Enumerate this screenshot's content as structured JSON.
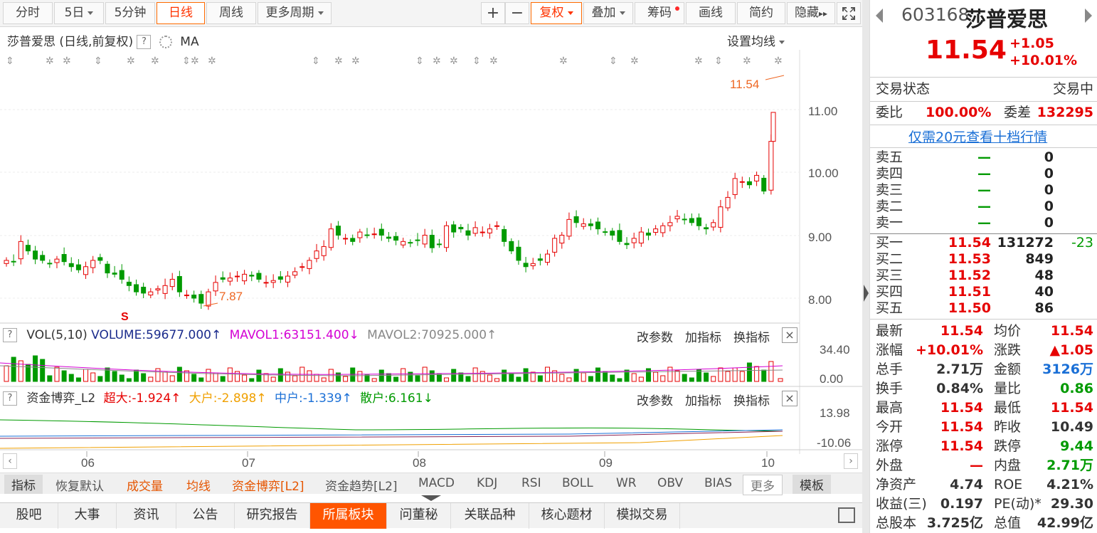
{
  "toolbar": {
    "items": [
      "分时",
      "5日",
      "5分钟",
      "日线",
      "周线",
      "更多周期"
    ],
    "right_items": [
      "复权",
      "叠加",
      "筹码",
      "画线",
      "简约",
      "隐藏"
    ],
    "plus": "+",
    "minus": "−",
    "hide_arrows": "▸▸"
  },
  "chart": {
    "title": "莎普爱思 (日线,前复权)",
    "help": "?",
    "ma_label": "MA",
    "ma_setting": "设置均线",
    "price_axis": [
      "11.00",
      "10.00",
      "9.00",
      "8.00"
    ],
    "high_marker": "11.54",
    "low_marker": "7.87",
    "s_marker": "S",
    "months": [
      "06",
      "07",
      "08",
      "09",
      "10"
    ]
  },
  "volume": {
    "help": "?",
    "label": "VOL(5,10)",
    "volume": "VOLUME:59677.000",
    "mavol1": "MAVOL1:63151.400",
    "mavol2": "MAVOL2:70925.000",
    "axis": [
      "34.40",
      "0.00"
    ],
    "buttons": [
      "改参数",
      "加指标",
      "换指标"
    ],
    "close": "×"
  },
  "capital": {
    "help": "?",
    "label": "资金博弈_L2",
    "chaoda": "超大:-1.924",
    "dahu": "大户:-2.898",
    "zhonghu": "中户:-1.339",
    "sanhu": "散户:6.161",
    "axis": [
      "13.98",
      "-10.06"
    ],
    "buttons": [
      "改参数",
      "加指标",
      "换指标"
    ],
    "close": "×"
  },
  "indicators": [
    "指标",
    "恢复默认",
    "成交量",
    "均线",
    "资金博弈[L2]",
    "资金趋势[L2]",
    "MACD",
    "KDJ",
    "RSI",
    "BOLL",
    "WR",
    "OBV",
    "BIAS",
    "更多",
    "模板"
  ],
  "tabs": [
    "股吧",
    "大事",
    "资讯",
    "公告",
    "研究报告",
    "所属板块",
    "问董秘",
    "关联品种",
    "核心题材",
    "模拟交易"
  ],
  "quote": {
    "code": "603168",
    "name": "莎普爱思",
    "price": "11.54",
    "change": "+1.05",
    "change_pct": "+10.01%",
    "status_label": "交易状态",
    "status": "交易中",
    "weibi_label": "委比",
    "weibi": "100.00%",
    "weicha_label": "委差",
    "weicha": "132295",
    "link": "仅需20元查看十档行情",
    "sell": [
      {
        "label": "卖五",
        "price": "—",
        "vol": "0"
      },
      {
        "label": "卖四",
        "price": "—",
        "vol": "0"
      },
      {
        "label": "卖三",
        "price": "—",
        "vol": "0"
      },
      {
        "label": "卖二",
        "price": "—",
        "vol": "0"
      },
      {
        "label": "卖一",
        "price": "—",
        "vol": "0"
      }
    ],
    "buy": [
      {
        "label": "买一",
        "price": "11.54",
        "vol": "131272",
        "delta": "-23"
      },
      {
        "label": "买二",
        "price": "11.53",
        "vol": "849",
        "delta": ""
      },
      {
        "label": "买三",
        "price": "11.52",
        "vol": "48",
        "delta": ""
      },
      {
        "label": "买四",
        "price": "11.51",
        "vol": "40",
        "delta": ""
      },
      {
        "label": "买五",
        "price": "11.50",
        "vol": "86",
        "delta": ""
      }
    ],
    "stats": [
      {
        "l1": "最新",
        "v1": "11.54",
        "l2": "均价",
        "v2": "11.54"
      },
      {
        "l1": "涨幅",
        "v1": "+10.01%",
        "l2": "涨跌",
        "v2": "▲1.05"
      },
      {
        "l1": "总手",
        "v1": "2.71万",
        "l2": "金额",
        "v2": "3126万"
      },
      {
        "l1": "换手",
        "v1": "0.84%",
        "l2": "量比",
        "v2": "0.86"
      },
      {
        "l1": "最高",
        "v1": "11.54",
        "l2": "最低",
        "v2": "11.54"
      },
      {
        "l1": "今开",
        "v1": "11.54",
        "l2": "昨收",
        "v2": "10.49"
      },
      {
        "l1": "涨停",
        "v1": "11.54",
        "l2": "跌停",
        "v2": "9.44"
      },
      {
        "l1": "外盘",
        "v1": "—",
        "l2": "内盘",
        "v2": "2.71万"
      },
      {
        "l1": "净资产",
        "v1": "4.74",
        "l2": "ROE",
        "v2": "4.21%"
      },
      {
        "l1": "收益(三)",
        "v1": "0.197",
        "l2": "PE(动)*",
        "v2": "29.30"
      },
      {
        "l1": "总股本",
        "v1": "3.725亿",
        "l2": "总值",
        "v2": "42.99亿"
      }
    ]
  },
  "colors": {
    "up": "#e60000",
    "down": "#009a00",
    "accent": "#ff5500"
  }
}
